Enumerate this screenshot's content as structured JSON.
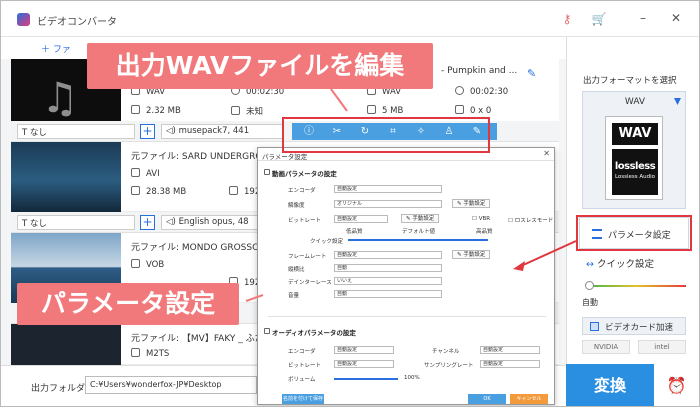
{
  "app": {
    "title": "ビデオコンバータ"
  },
  "toolbar": {
    "add_file": "ファ"
  },
  "files": [
    {
      "source": "",
      "title_tail": "- Pumpkin and ...",
      "input": {
        "format": "WAV",
        "size": "2.32 MB",
        "duration": "00:02:30",
        "resolution": "未知"
      },
      "output": {
        "format": "WAV",
        "size": "5 MB",
        "duration": "00:02:30",
        "resolution": "0 x 0"
      }
    },
    {
      "source": "元ファイル: SARD UNDERGROUND",
      "input": {
        "format": "AVI",
        "size": "28.38 MB",
        "resolution": "1920"
      }
    },
    {
      "source": "元ファイル: MONDO GROSSO _ S",
      "input": {
        "format": "VOB",
        "size": "",
        "resolution": "1920"
      }
    },
    {
      "source": "元ファイル: 【MV】FAKY _ ふた",
      "input": {
        "format": "M2TS"
      }
    }
  ],
  "option_bars": [
    {
      "subtitle": "なし",
      "audio": "musepack7, 441"
    },
    {
      "subtitle": "なし",
      "audio": "English opus, 48"
    },
    {
      "subtitle": "なし",
      "audio": ""
    }
  ],
  "edit_icons": [
    "info-icon",
    "cut-icon",
    "rotate-icon",
    "crop-icon",
    "effect-icon",
    "watermark-icon",
    "edit-icon"
  ],
  "output_folder": {
    "label": "出力フォルダ：",
    "path": "C:¥Users¥wonderfox-JP¥Desktop"
  },
  "format_panel": {
    "title": "出力フォーマットを選択",
    "format": "WAV",
    "card_top": "WAV",
    "card_logo": "lossless",
    "card_sub": "Lossless Audio",
    "param_button": "パラメータ設定",
    "quick_settings": "クイック設定",
    "auto_label": "自動",
    "gpu_button": "ビデオカード加速",
    "vendors": [
      "NVIDIA",
      "intel"
    ]
  },
  "convert": {
    "label": "変換"
  },
  "dialog": {
    "title": "パラメータ設定",
    "video_section": "動画パラメータの設定",
    "audio_section": "オーディオパラメータの設定",
    "video_rows": [
      {
        "label": "エンコーダ",
        "value": "自動設定"
      },
      {
        "label": "解像度",
        "value": "オリジナル",
        "button": "手動設定"
      },
      {
        "label": "ビットレート",
        "value": "自動設定",
        "button": "手動設定",
        "check1": "VBR",
        "check2": "ロスレスモード"
      },
      {
        "label": "クイック設定",
        "low": "低品質",
        "mid": "デフォルト値",
        "high": "高品質"
      },
      {
        "label": "フレームレート",
        "value": "自動設定",
        "button": "手動設定"
      },
      {
        "label": "縦横比",
        "value": "自動"
      },
      {
        "label": "デインターレース",
        "value": "いいえ"
      },
      {
        "label": "音量",
        "value": "自動"
      }
    ],
    "audio_rows": [
      {
        "label": "エンコーダ",
        "value": "自動設定",
        "label2": "チャンネル",
        "value2": "自動設定"
      },
      {
        "label": "ビットレート",
        "value": "自動設定",
        "label2": "サンプリングレート",
        "value2": "自動設定"
      },
      {
        "label": "ボリューム",
        "value": "100%"
      }
    ],
    "footer": {
      "save": "名前を付けて保存",
      "ok": "OK",
      "cancel": "キャンセル"
    }
  },
  "callouts": {
    "edit": "出力WAVファイルを編集",
    "param": "パラメータ設定"
  },
  "colors": {
    "accent": "#2a8fe0",
    "callout": "#f2797b",
    "highlight": "#e0383e"
  }
}
